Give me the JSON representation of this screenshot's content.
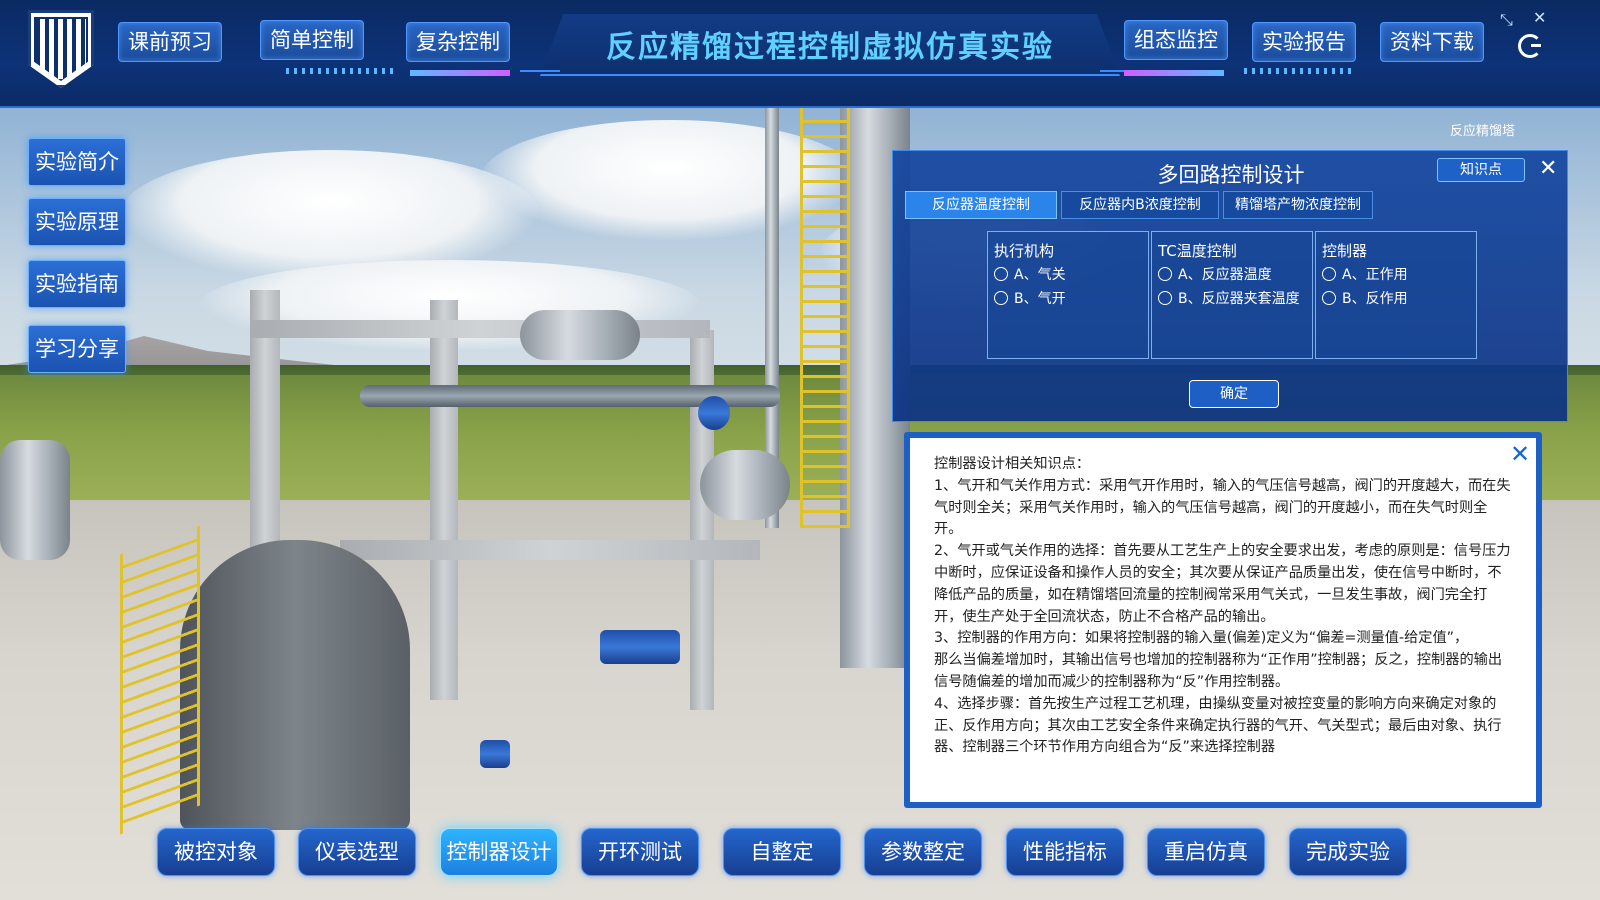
{
  "header": {
    "title": "反应精馏过程控制虚拟仿真实验",
    "nav_left": [
      "课前预习",
      "简单控制",
      "复杂控制"
    ],
    "nav_right": [
      "组态监控",
      "实验报告",
      "资料下载"
    ],
    "icons": {
      "shrink": "shrink-icon",
      "close": "close-icon",
      "refresh": "refresh-icon"
    }
  },
  "sidebar": {
    "items": [
      "实验简介",
      "实验原理",
      "实验指南",
      "学习分享"
    ]
  },
  "scene": {
    "corner_label": "反应精馏塔"
  },
  "panel": {
    "title": "多回路控制设计",
    "knowledge_label": "知识点",
    "tabs": [
      "反应器温度控制",
      "反应器内B浓度控制",
      "精馏塔产物浓度控制"
    ],
    "active_tab": 0,
    "groups": [
      {
        "heading": "执行机构",
        "options": [
          "A、气关",
          "B、气开"
        ]
      },
      {
        "heading": "TC温度控制",
        "options": [
          "A、反应器温度",
          "B、反应器夹套温度"
        ]
      },
      {
        "heading": "控制器",
        "options": [
          "A、正作用",
          "B、反作用"
        ]
      }
    ],
    "confirm_label": "确定"
  },
  "knowledge": {
    "lines": [
      "控制器设计相关知识点：",
      "1、气开和气关作用方式：采用气开作用时，输入的气压信号越高，阀门的开度越大，而在失气时则全关；采用气关作用时，输入的气压信号越高，阀门的开度越小，而在失气时则全开。",
      "2、气开或气关作用的选择：首先要从工艺生产上的安全要求出发，考虑的原则是：信号压力中断时，应保证设备和操作人员的安全；其次要从保证产品质量出发，使在信号中断时，不降低产品的质量，如在精馏塔回流量的控制阀常采用气关式，一旦发生事故，阀门完全打开，使生产处于全回流状态，防止不合格产品的输出。",
      "3、控制器的作用方向：如果将控制器的输入量(偏差)定义为“偏差=测量值-给定值”，",
      "那么当偏差增加时，其输出信号也增加的控制器称为“正作用”控制器；反之，控制器的输出信号随偏差的增加而减少的控制器称为“反”作用控制器。",
      "4、选择步骤：首先按生产过程工艺机理，由操纵变量对被控变量的影响方向来确定对象的正、反作用方向；其次由工艺安全条件来确定执行器的气开、气关型式；最后由对象、执行器、控制器三个环节作用方向组合为“反”来选择控制器"
    ]
  },
  "toolbar": {
    "items": [
      "被控对象",
      "仪表选型",
      "控制器设计",
      "开环测试",
      "自整定",
      "参数整定",
      "性能指标",
      "重启仿真",
      "完成实验"
    ],
    "active_index": 2
  },
  "colors": {
    "header_bg": "#0b2b66",
    "accent": "#2a84ea",
    "title": "#5fd0ff",
    "active_button": "#2fb4ff"
  }
}
